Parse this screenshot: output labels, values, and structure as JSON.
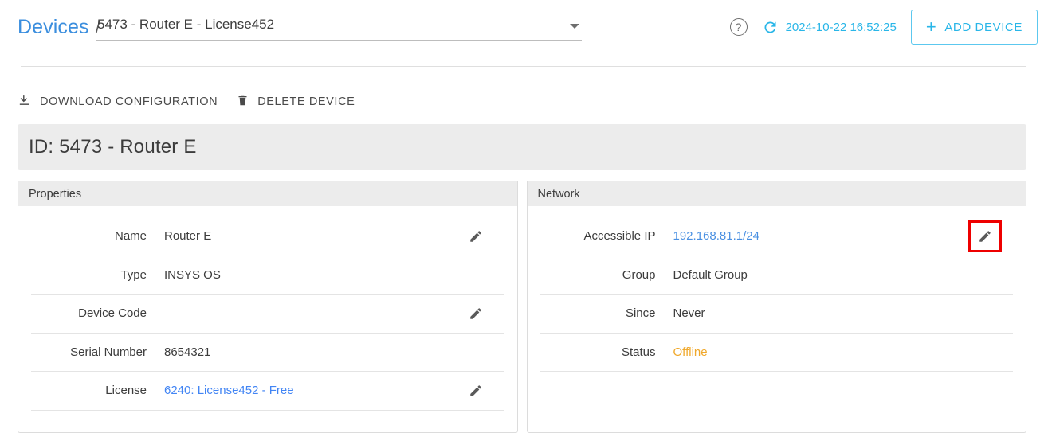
{
  "header": {
    "breadcrumb_root": "Devices",
    "breadcrumb_separator": "/",
    "device_select_value": "5473 - Router E - License452",
    "help_icon_glyph": "?",
    "timestamp": "2024-10-22 16:52:25",
    "add_device_label": "ADD DEVICE",
    "add_device_plus": "+",
    "accent_blue": "#29b6e8",
    "link_blue": "#4a90e2"
  },
  "actions": [
    {
      "label": "DOWNLOAD CONFIGURATION",
      "icon": "download-icon"
    },
    {
      "label": "DELETE DEVICE",
      "icon": "trash-icon"
    }
  ],
  "title": "ID: 5473 - Router E",
  "panels": [
    {
      "title": "Properties",
      "rows": [
        {
          "label": "Name",
          "value": "Router E",
          "style": "plain",
          "editable": true
        },
        {
          "label": "Type",
          "value": "INSYS OS",
          "style": "plain",
          "editable": false
        },
        {
          "label": "Device Code",
          "value": "",
          "style": "plain",
          "editable": true
        },
        {
          "label": "Serial Number",
          "value": "8654321",
          "style": "plain",
          "editable": false
        },
        {
          "label": "License",
          "value": "6240: License452 - Free",
          "style": "link-bright",
          "editable": true
        }
      ]
    },
    {
      "title": "Network",
      "rows": [
        {
          "label": "Accessible IP",
          "value": "192.168.81.1/24",
          "style": "link",
          "editable": true,
          "highlighted": true
        },
        {
          "label": "Group",
          "value": "Default Group",
          "style": "plain",
          "editable": false
        },
        {
          "label": "Since",
          "value": "Never",
          "style": "plain",
          "editable": false
        },
        {
          "label": "Status",
          "value": "Offline",
          "style": "status-offline",
          "editable": false
        }
      ]
    }
  ],
  "highlight_color": "#ee0000"
}
